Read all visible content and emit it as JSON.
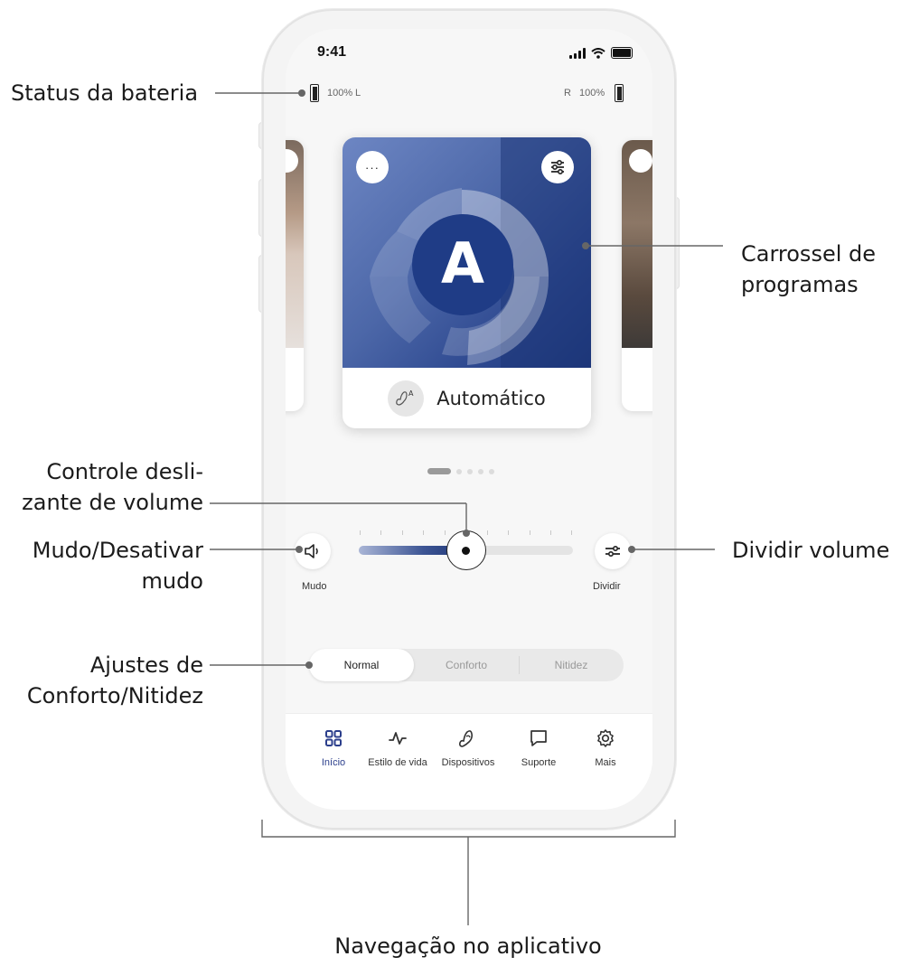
{
  "annotations": {
    "battery": "Status da bateria",
    "carousel": [
      "Carrossel de",
      "programas"
    ],
    "volume_slider": [
      "Controle desli-",
      "zante de volume"
    ],
    "mute": [
      "Mudo/Desativar",
      "mudo"
    ],
    "split": "Dividir volume",
    "comfort": [
      "Ajustes de",
      "Conforto/Nitidez"
    ],
    "navigation": "Navegação no aplicativo"
  },
  "status_bar": {
    "time": "9:41"
  },
  "battery": {
    "left": {
      "percent": "100%",
      "side": "L"
    },
    "right": {
      "side": "R",
      "percent": "100%"
    }
  },
  "carousel": {
    "program_letter": "A",
    "program_name": "Automático",
    "more_icon": "ellipsis-icon",
    "settings_icon": "sliders-icon",
    "page_count": 5,
    "active_page": 1
  },
  "volume": {
    "mute_label": "Mudo",
    "split_label": "Dividir",
    "level": 0.5,
    "mute_icon": "speaker-icon",
    "split_icon": "split-sliders-icon"
  },
  "sound_modes": {
    "options": [
      "Normal",
      "Conforto",
      "Nitidez"
    ],
    "selected": "Normal"
  },
  "nav": {
    "items": [
      {
        "label": "Início",
        "icon": "grid-icon",
        "active": true
      },
      {
        "label": "Estilo de vida",
        "icon": "pulse-icon",
        "active": false
      },
      {
        "label": "Dispositivos",
        "icon": "hearing-aid-icon",
        "active": false
      },
      {
        "label": "Suporte",
        "icon": "chat-icon",
        "active": false
      },
      {
        "label": "Mais",
        "icon": "gear-icon",
        "active": false
      }
    ],
    "active_color": "#2c3f8c"
  },
  "colors": {
    "program_card_dark": "#1c367a",
    "program_card_light": "#6d86c3"
  }
}
